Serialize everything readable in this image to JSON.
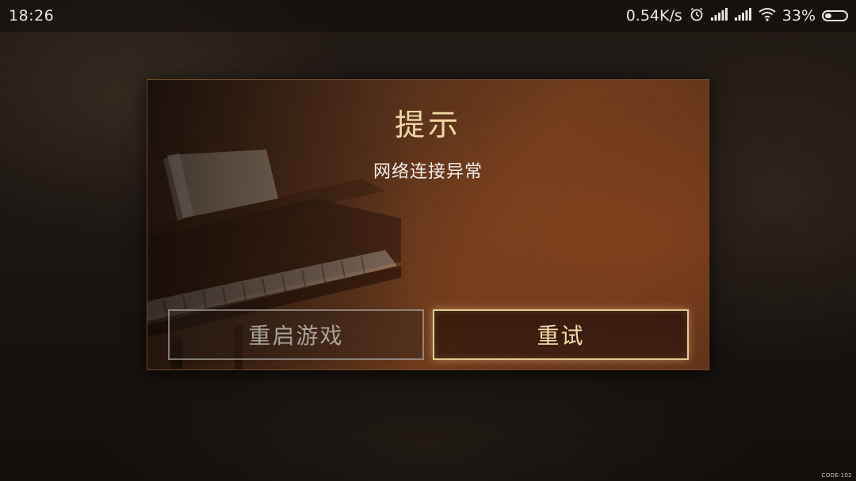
{
  "status_bar": {
    "time": "18:26",
    "network_speed": "0.54K/s",
    "battery_percent": "33%",
    "battery_level": 0.33,
    "icons": [
      "alarm-clock-icon",
      "cellular-signal-icon",
      "cellular-signal-icon",
      "wifi-icon",
      "battery-icon"
    ]
  },
  "dialog": {
    "title": "提示",
    "message": "网络连接异常",
    "buttons": {
      "restart_label": "重启游戏",
      "retry_label": "重试"
    }
  },
  "watermark": "CODE-102",
  "colors": {
    "title": "#f2d9a4",
    "retry_border": "#e2c98f",
    "dialog_base": "#6e3a1a"
  }
}
